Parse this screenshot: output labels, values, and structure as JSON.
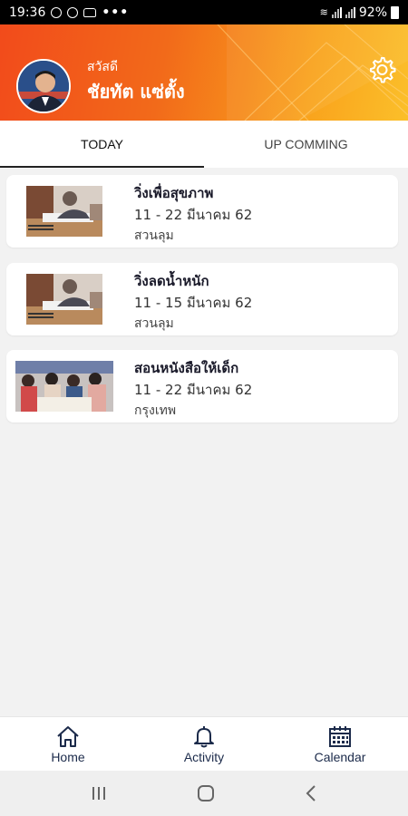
{
  "status_bar": {
    "time": "19:36",
    "dots": "•••",
    "battery": "92%"
  },
  "header": {
    "greeting": "สวัสดี",
    "user_name": "ชัยทัต  แซ่ตั้ง"
  },
  "tabs": [
    {
      "label": "TODAY",
      "active": true
    },
    {
      "label": "UP COMMING",
      "active": false
    }
  ],
  "activities": [
    {
      "title": "วิ่งเพื่อสุขภาพ",
      "date": "11 - 22 มีนาคม 62",
      "location": "สวนลุม"
    },
    {
      "title": "วิ่งลดน้ำหนัก",
      "date": "11 - 15 มีนาคม 62",
      "location": "สวนลุม"
    },
    {
      "title": "สอนหนังสือให้เด็ก",
      "date": "11 - 22 มีนาคม 62",
      "location": "กรุงเทพ"
    }
  ],
  "bottom_nav": [
    {
      "label": "Home",
      "icon": "home-icon"
    },
    {
      "label": "Activity",
      "icon": "bell-icon"
    },
    {
      "label": "Calendar",
      "icon": "calendar-icon"
    }
  ],
  "colors": {
    "header_start": "#f24b1b",
    "header_end": "#fbbf2a",
    "nav_text": "#1b2a4a"
  }
}
